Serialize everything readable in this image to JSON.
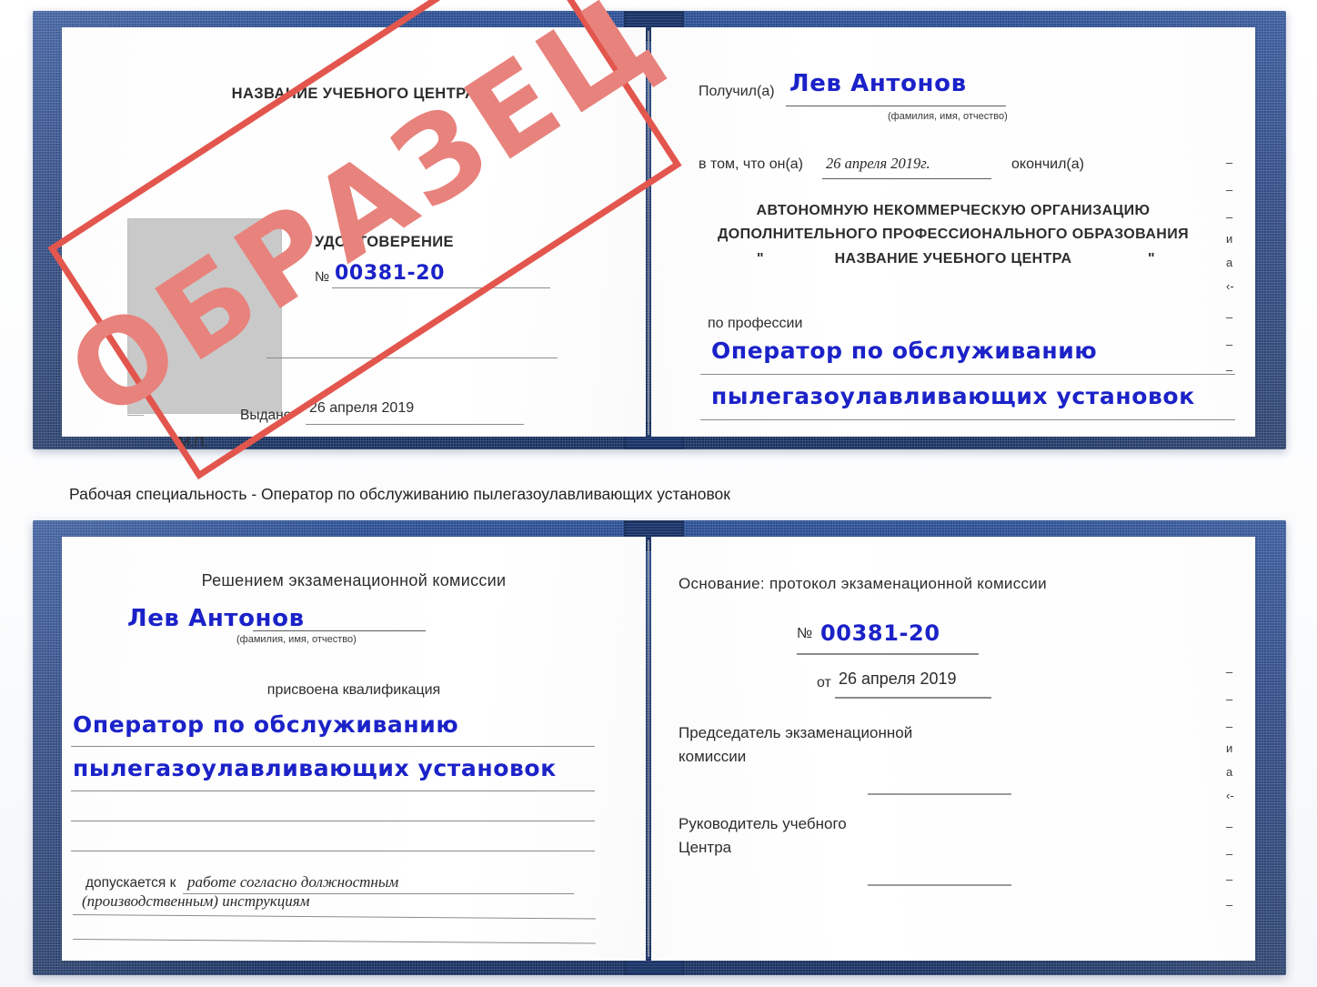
{
  "document": {
    "kind": "certificate-scan",
    "caption": "Рабочая специальность - Оператор по обслуживанию пылегазоулавливающих установок"
  },
  "colors": {
    "cover_blue": "#1f3d7a",
    "stamp_border_red": "#e3564d",
    "stamp_text_red": "#e8827c",
    "handwriting_blue": "#1b22c8",
    "photo_gray": "#c9c9c9"
  },
  "certificate_top": {
    "left_page": {
      "org_title": "НАЗВАНИЕ УЧЕБНОГО ЦЕНТРА",
      "doc_type": "УДОСТОВЕРЕНИЕ",
      "number_label": "№",
      "number_value": "00381-20",
      "issued_label": "Выдано",
      "issued_value": "26 апреля 2019",
      "seal_label": "М.П.",
      "photo_placeholder": ""
    },
    "right_page": {
      "received_label": "Получил(а)",
      "received_value": "Лев Антонов",
      "name_hint": "(фамилия, имя, отчество)",
      "in_that_label": "в том, что он(а)",
      "in_that_value": "26 апреля 2019г.",
      "finished_label": "окончил(а)",
      "org_line_1": "АВТОНОМНУЮ НЕКОММЕРЧЕСКУЮ ОРГАНИЗАЦИЮ",
      "org_line_2": "ДОПОЛНИТЕЛЬНОГО ПРОФЕССИОНАЛЬНОГО ОБРАЗОВАНИЯ",
      "org_quote_open": "\"",
      "org_line_3": "НАЗВАНИЕ УЧЕБНОГО ЦЕНТРА",
      "org_quote_close": "\"",
      "profession_label": "по профессии",
      "profession_value_1": "Оператор по обслуживанию",
      "profession_value_2": "пылегазоулавливающих установок"
    },
    "edge_marks": [
      "–",
      "–",
      "–",
      "и",
      "а",
      "‹-",
      "–",
      "–",
      "–"
    ]
  },
  "certificate_bottom": {
    "left_page": {
      "decision_title": "Решением экзаменационной комиссии",
      "name_value": "Лев Антонов",
      "name_hint": "(фамилия, имя, отчество)",
      "qualification_label": "присвоена квалификация",
      "qualification_value_1": "Оператор по обслуживанию",
      "qualification_value_2": "пылегазоулавливающих установок",
      "admitted_label": "допускается к",
      "admitted_value_1": "работе согласно должностным",
      "admitted_value_2": "(производственным) инструкциям"
    },
    "right_page": {
      "basis_label": "Основание: протокол экзаменационной комиссии",
      "protocol_number_label": "№",
      "protocol_number_value": "00381-20",
      "protocol_date_label": "от",
      "protocol_date_value": "26 апреля 2019",
      "chairman_line_1": "Председатель экзаменационной",
      "chairman_line_2": "комиссии",
      "head_line_1": "Руководитель учебного",
      "head_line_2": "Центра"
    },
    "edge_marks": [
      "–",
      "–",
      "–",
      "и",
      "а",
      "‹-",
      "–",
      "–",
      "–",
      "–"
    ]
  },
  "stamp": {
    "text": "ОБРАЗЕЦ"
  }
}
